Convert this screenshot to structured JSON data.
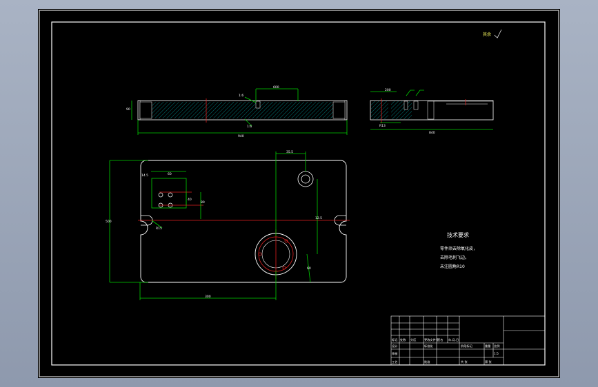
{
  "drawing": {
    "signature_mark": "其余",
    "tech_req": {
      "title": "技术要求",
      "lines": [
        "零件须去除氧化皮，",
        "去除毛刺飞边。",
        "未注圆角R10"
      ]
    },
    "dims": {
      "top_width": "600",
      "top_side": "90",
      "overall": "940",
      "mark_a": "1:6",
      "mark_b": "1:6",
      "side_a": "200",
      "side_b": "840",
      "side_c": "R13",
      "plan_a": "35.5",
      "plan_b": "14.5",
      "plan_c": "60",
      "plan_d": "40",
      "plan_e": "80",
      "plan_f": "12.5",
      "plan_g": "R15",
      "plan_h": "500",
      "plan_i": "60",
      "plan_bottom": "300"
    },
    "title_block": {
      "r1": [
        "标记",
        "处数",
        "分区",
        "更改文件号",
        "签名",
        "年.月.日"
      ],
      "r2": [
        "设计",
        "",
        "标准化",
        "",
        "阶段标记",
        "重量",
        "比例"
      ],
      "r3": [
        "审核",
        "",
        "",
        "",
        "",
        "",
        "1:5"
      ],
      "r4": [
        "工艺",
        "",
        "批准",
        "",
        "共  张",
        "第  张"
      ]
    }
  }
}
